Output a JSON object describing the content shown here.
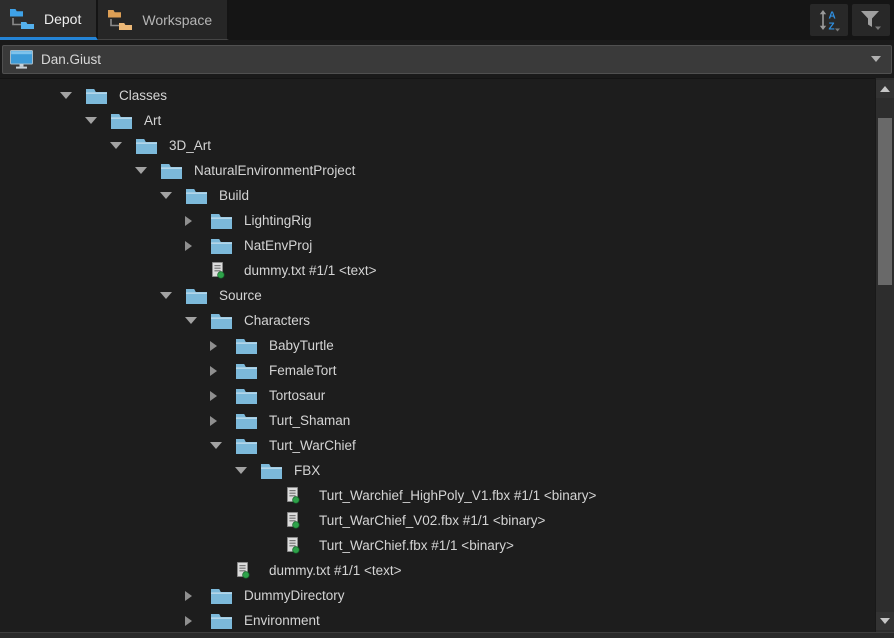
{
  "tabs": [
    {
      "label": "Depot",
      "active": true,
      "icon": "depot-folders-icon"
    },
    {
      "label": "Workspace",
      "active": false,
      "icon": "workspace-folders-icon"
    }
  ],
  "toolbar": {
    "sort_button_icon": "sort-alpha-icon",
    "filter_button_icon": "filter-funnel-icon"
  },
  "connection": {
    "value": "Dan.Giust",
    "icon": "computer-monitor-icon"
  },
  "tree": {
    "rows": [
      {
        "label": "Classes",
        "level": 0,
        "kind": "folder",
        "expanded": true
      },
      {
        "label": "Art",
        "level": 1,
        "kind": "folder",
        "expanded": true
      },
      {
        "label": "3D_Art",
        "level": 2,
        "kind": "folder",
        "expanded": true
      },
      {
        "label": "NaturalEnvironmentProject",
        "level": 3,
        "kind": "folder",
        "expanded": true
      },
      {
        "label": "Build",
        "level": 4,
        "kind": "folder",
        "expanded": true
      },
      {
        "label": "LightingRig",
        "level": 5,
        "kind": "folder",
        "expanded": false
      },
      {
        "label": "NatEnvProj",
        "level": 5,
        "kind": "folder",
        "expanded": false
      },
      {
        "label": "dummy.txt #1/1 <text>",
        "level": 5,
        "kind": "file"
      },
      {
        "label": "Source",
        "level": 4,
        "kind": "folder",
        "expanded": true
      },
      {
        "label": "Characters",
        "level": 5,
        "kind": "folder",
        "expanded": true
      },
      {
        "label": "BabyTurtle",
        "level": 6,
        "kind": "folder",
        "expanded": false
      },
      {
        "label": "FemaleTort",
        "level": 6,
        "kind": "folder",
        "expanded": false
      },
      {
        "label": "Tortosaur",
        "level": 6,
        "kind": "folder",
        "expanded": false
      },
      {
        "label": "Turt_Shaman",
        "level": 6,
        "kind": "folder",
        "expanded": false
      },
      {
        "label": "Turt_WarChief",
        "level": 6,
        "kind": "folder",
        "expanded": true
      },
      {
        "label": "FBX",
        "level": 7,
        "kind": "folder",
        "expanded": true
      },
      {
        "label": "Turt_Warchief_HighPoly_V1.fbx #1/1 <binary>",
        "level": 8,
        "kind": "file"
      },
      {
        "label": "Turt_WarChief_V02.fbx #1/1 <binary>",
        "level": 8,
        "kind": "file"
      },
      {
        "label": "Turt_WarChief.fbx #1/1 <binary>",
        "level": 8,
        "kind": "file"
      },
      {
        "label": "dummy.txt #1/1 <text>",
        "level": 6,
        "kind": "file"
      },
      {
        "label": "DummyDirectory",
        "level": 5,
        "kind": "folder",
        "expanded": false
      },
      {
        "label": "Environment",
        "level": 5,
        "kind": "folder",
        "expanded": false
      }
    ]
  },
  "colors": {
    "accent_blue": "#2484d6",
    "folder_blue": "#7cb9da",
    "depot_icon_blue": "#3fa2e8",
    "workspace_icon_orange": "#e2a55e",
    "file_status_green": "#2ea24a",
    "sort_letters_blue": "#2f8fe0"
  }
}
